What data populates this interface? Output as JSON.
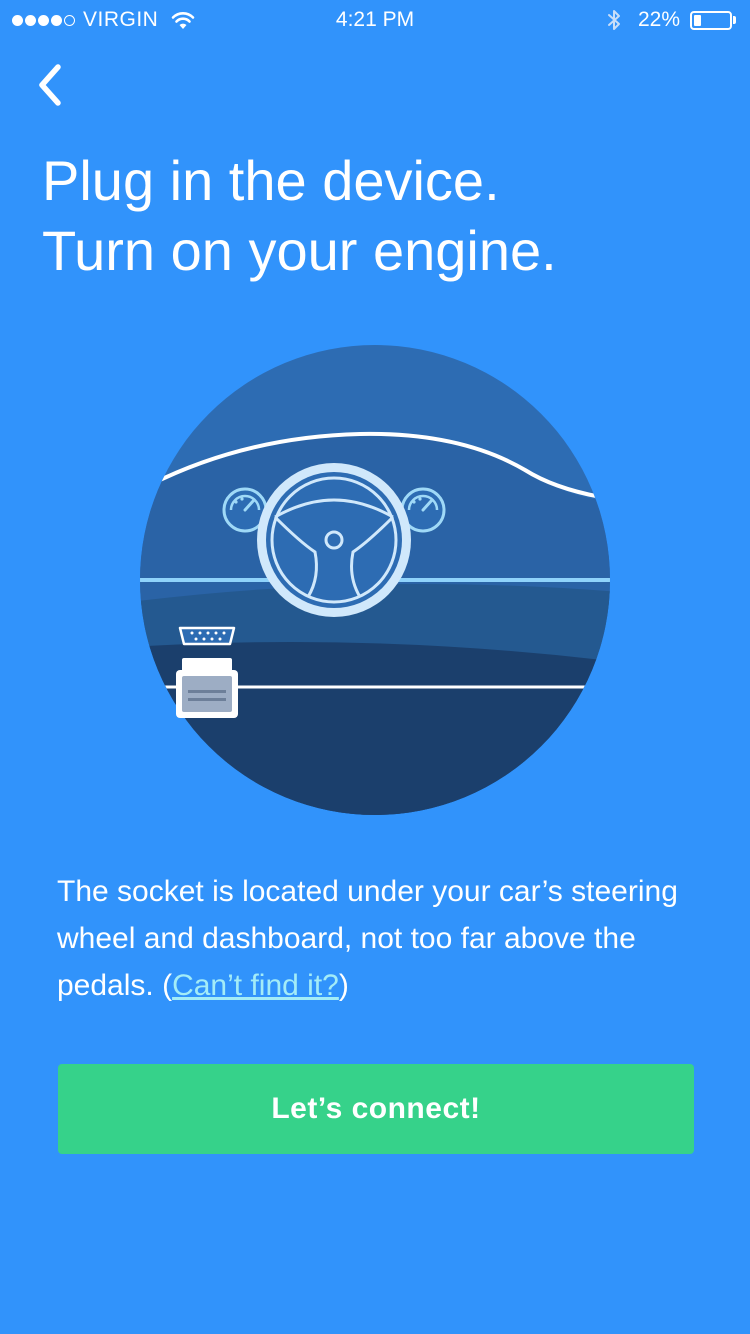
{
  "status_bar": {
    "carrier": "VIRGIN",
    "time": "4:21 PM",
    "battery_percent": "22%",
    "battery_level": 0.22,
    "signal_bars_filled": 4,
    "signal_bars_total": 5,
    "icons": [
      "signal-dots",
      "wifi-icon",
      "bluetooth-icon",
      "battery-icon"
    ]
  },
  "nav": {
    "back_icon": "chevron-left-icon"
  },
  "title": {
    "line1": "Plug in the device.",
    "line2": "Turn on your engine."
  },
  "illustration": {
    "subject": "car dashboard with steering wheel and OBD device",
    "colors": {
      "circle_top": "#2d6fb6",
      "circle_bottom": "#1a3e69",
      "line": "#ffffff",
      "accent_line": "#8fd3fb",
      "gauge": "#9fd9f7"
    }
  },
  "description": {
    "text": "The socket is located under your car’s steering wheel and dashboard, not too far above the pedals. (",
    "link": "Can’t find it?",
    "suffix": ")"
  },
  "actions": {
    "connect_label": "Let’s connect!"
  },
  "colors": {
    "background": "#3193fb",
    "button": "#36d28a",
    "link": "#a3ecf7",
    "text": "#ffffff"
  }
}
